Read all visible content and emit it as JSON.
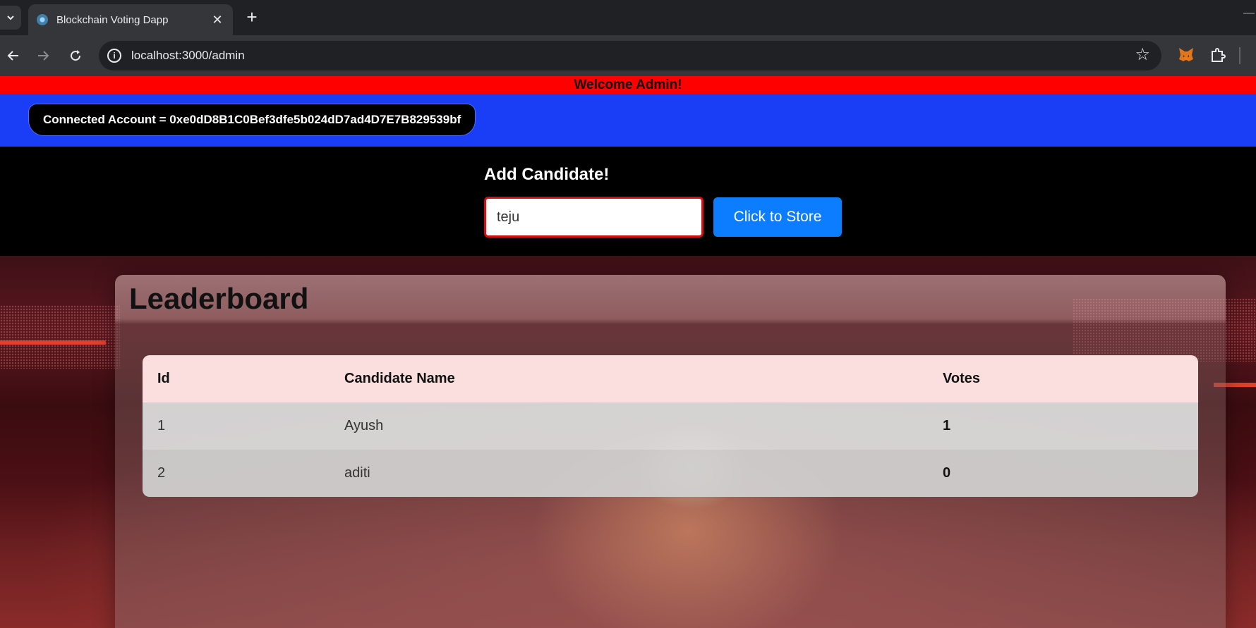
{
  "browser": {
    "tab_title": "Blockchain Voting Dapp",
    "tab_close": "✕",
    "new_tab": "+",
    "url": "localhost:3000/admin",
    "icons": [
      "tab-search-icon",
      "favicon-icon",
      "back-arrow-icon",
      "forward-arrow-icon",
      "reload-icon",
      "site-info-icon",
      "bookmark-star-icon",
      "metamask-fox-icon",
      "extensions-puzzle-icon"
    ]
  },
  "banner": {
    "welcome": "Welcome Admin!"
  },
  "account": {
    "label": "Connected Account = 0xe0dD8B1C0Bef3dfe5b024dD7ad4D7E7B829539bf"
  },
  "add_candidate": {
    "title": "Add Candidate!",
    "input_value": "teju",
    "button_label": "Click to Store"
  },
  "leaderboard": {
    "title": "Leaderboard",
    "columns": [
      "Id",
      "Candidate Name",
      "Votes"
    ],
    "rows": [
      {
        "id": "1",
        "name": "Ayush",
        "votes": "1"
      },
      {
        "id": "2",
        "name": "aditi",
        "votes": "0"
      }
    ]
  },
  "colors": {
    "welcome_bg": "#ff0000",
    "account_bar_bg": "#1a3ef5",
    "store_button": "#0d7dff",
    "input_border": "#d41010",
    "table_header_bg": "#fbdede"
  }
}
